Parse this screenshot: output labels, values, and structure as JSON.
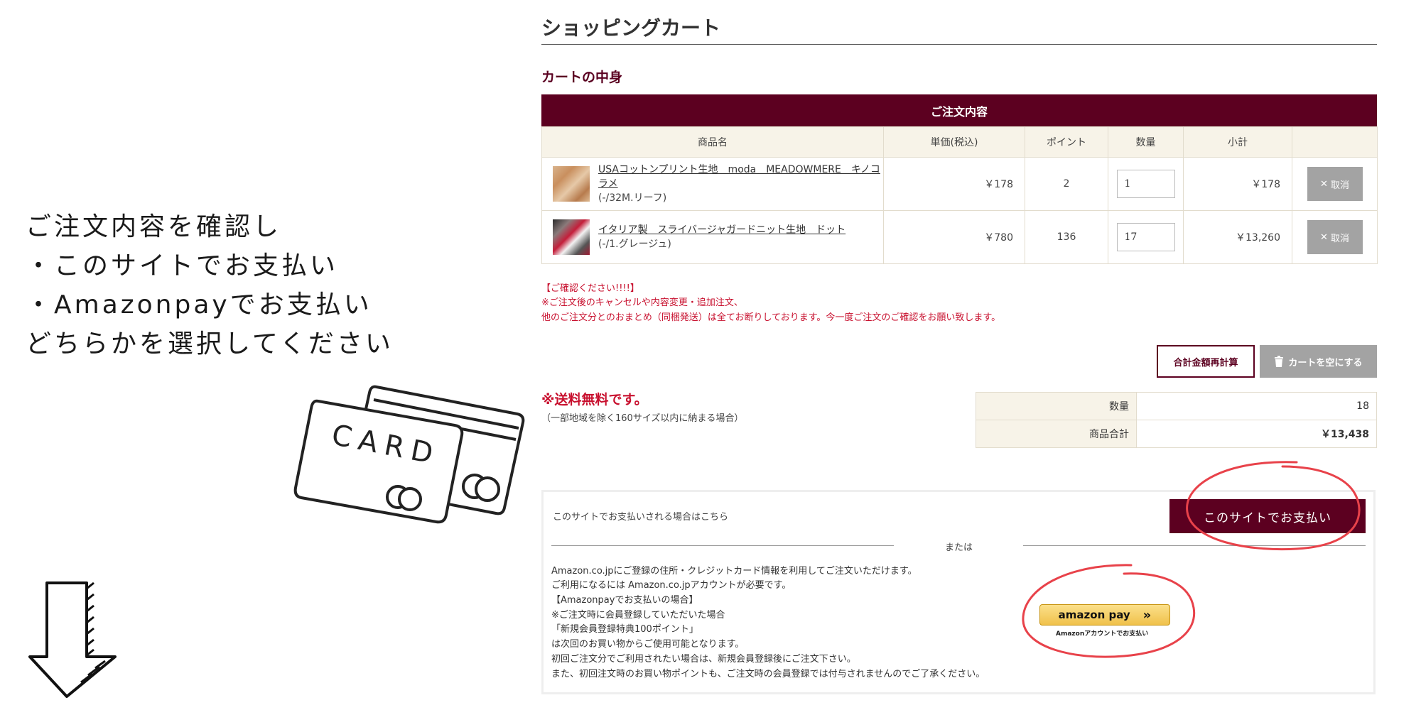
{
  "annotation": {
    "lines": [
      "ご注文内容を確認し",
      "・このサイトでお支払い",
      "・Amazonpayでお支払い",
      "どちらかを選択してください"
    ],
    "card_text": "CARD"
  },
  "page": {
    "title": "ショッピングカート",
    "section_heading": "カートの中身",
    "order_header": "ご注文内容"
  },
  "cart": {
    "columns": [
      "商品名",
      "単価(税込)",
      "ポイント",
      "数量",
      "小計",
      ""
    ],
    "items": [
      {
        "name": "USAコットンプリント生地　moda　MEADOWMERE　キノコラメ",
        "variant": "(-/32M.リーフ)",
        "price": "￥178",
        "points": "2",
        "quantity": "1",
        "subtotal": "￥178",
        "cancel_label": "取消"
      },
      {
        "name": "イタリア製　スライバージャガードニット生地　ドット",
        "variant": "(-/1.グレージュ)",
        "price": "￥780",
        "points": "136",
        "quantity": "17",
        "subtotal": "￥13,260",
        "cancel_label": "取消"
      }
    ]
  },
  "warning": {
    "lines": [
      "【ご確認ください!!!!】",
      "※ご注文後のキャンセルや内容変更・追加注文、",
      "他のご注文分とのおまとめ（同梱発送）は全てお断りしております。今一度ご注文のご確認をお願い致します。"
    ]
  },
  "actions": {
    "recalc_label": "合計金額再計算",
    "empty_label": "カートを空にする"
  },
  "shipping": {
    "free_label": "※送料無料です。",
    "note": "（一部地域を除く160サイズ以内に納まる場合）"
  },
  "summary": {
    "qty_label": "数量",
    "qty_value": "18",
    "total_label": "商品合計",
    "total_value": "￥13,438"
  },
  "payment": {
    "site_pay_text": "このサイトでお支払いされる場合はこちら",
    "site_pay_button": "このサイトでお支払い",
    "or_text": "または",
    "amazon_lines": [
      "Amazon.co.jpにご登録の住所・クレジットカード情報を利用してご注文いただけます。",
      "ご利用になるには Amazon.co.jpアカウントが必要です。",
      "【Amazonpayでお支払いの場合】",
      "※ご注文時に会員登録していただいた場合",
      "「新規会員登録特典100ポイント」",
      "は次回のお買い物からご使用可能となります。",
      "初回ご注文分でご利用されたい場合は、新規会員登録後にご注文下さい。",
      "また、初回注文時のお買い物ポイントも、ご注文時の会員登録では付与されませんのでご了承ください。"
    ],
    "amazon_button_logo": "amazon pay",
    "amazon_button_arrow": "»",
    "amazon_button_caption": "Amazonアカウントでお支払い"
  },
  "icons": {
    "cancel": "close-icon",
    "empty_cart": "trash-icon",
    "amazon_arrow": "double-chevron-right-icon"
  },
  "colors": {
    "brand": "#5c0020",
    "warning": "#c8102e",
    "header_cell_bg": "#f7f3e8",
    "disabled_button": "#a3a3a3",
    "highlight_circle": "#e8424a"
  }
}
